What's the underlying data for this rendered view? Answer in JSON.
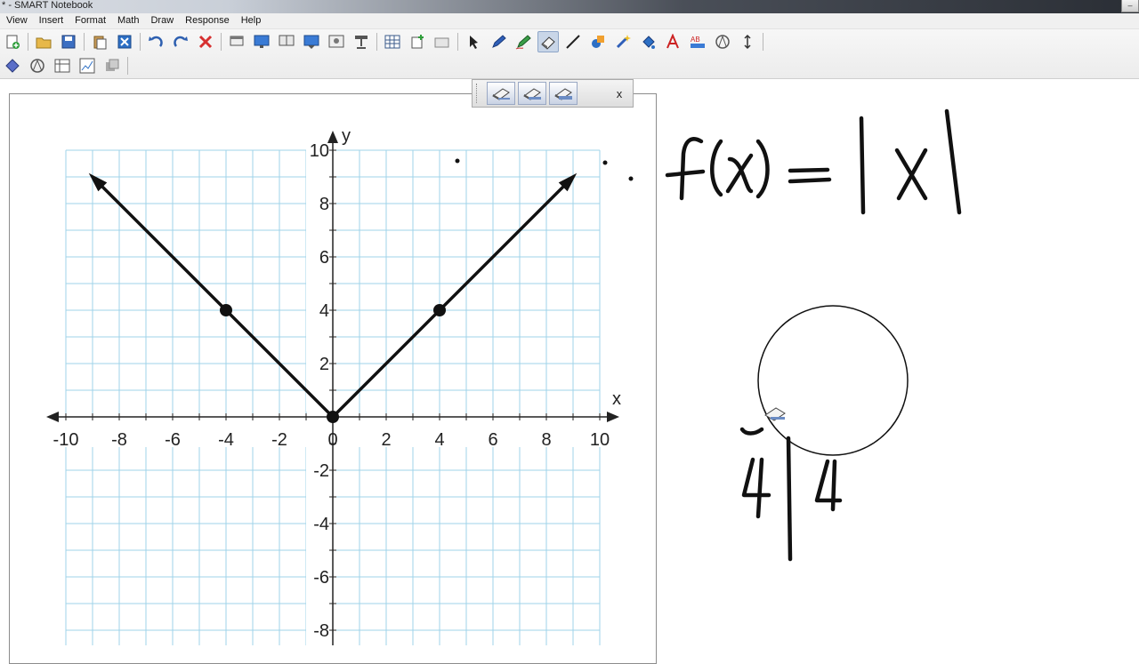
{
  "window": {
    "title": "* - SMART Notebook"
  },
  "menu": [
    "View",
    "Insert",
    "Format",
    "Math",
    "Draw",
    "Response",
    "Help"
  ],
  "toolbar": {
    "row1": [
      "new-page-icon",
      "open-folder-icon",
      "save-icon",
      "paste-icon",
      "delete-page-icon",
      "undo-icon",
      "redo-icon",
      "delete-icon",
      "screen-shade-icon",
      "full-screen-icon",
      "dual-page-icon",
      "capture-icon",
      "insert-media-icon",
      "document-camera-icon",
      "table-icon",
      "add-page-icon",
      "attach-icon",
      "select-icon",
      "pen-icon",
      "creative-pen-icon",
      "eraser-icon",
      "line-icon",
      "shapes-icon",
      "magic-pen-icon",
      "fill-icon",
      "text-icon",
      "properties-icon",
      "math-tools-icon",
      "move-toolbar-icon"
    ],
    "row2": [
      "shape-recognition-icon",
      "measure-icon",
      "table-tool-icon",
      "graph-icon",
      "response-icon"
    ],
    "active": "eraser-icon"
  },
  "floating_toolbar": {
    "buttons": [
      "eraser-small-icon",
      "eraser-medium-icon",
      "eraser-large-icon"
    ],
    "close_label": "x"
  },
  "handwriting": {
    "equation": "f(x) = |x|",
    "left_value": "-4",
    "right_value": "4"
  },
  "chart_data": {
    "type": "line",
    "xlabel": "x",
    "ylabel": "y",
    "xlim": [
      -10,
      10
    ],
    "ylim": [
      -8,
      10
    ],
    "xticks": [
      -10,
      -8,
      -6,
      -4,
      -2,
      0,
      2,
      4,
      6,
      8,
      10
    ],
    "yticks": [
      10,
      8,
      6,
      4,
      2,
      -2,
      -4,
      -6,
      -8
    ],
    "grid": true,
    "series": [
      {
        "x": [
          -9,
          -4,
          0,
          4,
          9
        ],
        "y": [
          9,
          4,
          0,
          4,
          9
        ],
        "arrows": true
      }
    ],
    "points": [
      {
        "x": -4,
        "y": 4
      },
      {
        "x": 0,
        "y": 0
      },
      {
        "x": 4,
        "y": 4
      }
    ]
  }
}
